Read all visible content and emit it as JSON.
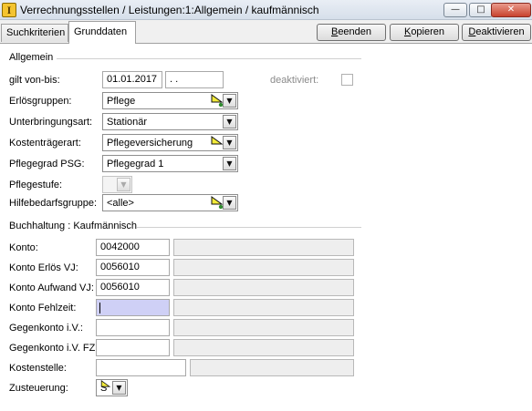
{
  "window": {
    "title": "Verrechnungsstellen / Leistungen:1:Allgemein / kaufmännisch",
    "app_icon_letter": "I",
    "minimize_glyph": "—",
    "maximize_glyph": "□",
    "close_glyph": "✕"
  },
  "tabs": [
    {
      "label": "Suchkriterien",
      "active": false
    },
    {
      "label": "Grunddaten",
      "active": true
    }
  ],
  "toolbar": {
    "beenden": {
      "pre": "",
      "key": "B",
      "post": "eenden"
    },
    "kopieren": {
      "pre": "",
      "key": "K",
      "post": "opieren"
    },
    "deaktivieren": {
      "pre": "",
      "key": "D",
      "post": "eaktivieren"
    }
  },
  "allgemein": {
    "section_title": "Allgemein",
    "gilt_label": "gilt von-bis:",
    "gilt_von": "01.01.2017",
    "gilt_bis": " .  .",
    "deaktiviert_label": "deaktiviert:",
    "deaktiviert_checked": false,
    "erloesgruppen_label": "Erlösgruppen:",
    "erloesgruppen_value": "Pflege",
    "unterbringungsart_label": "Unterbringungsart:",
    "unterbringungsart_value": "Stationär",
    "kostentraegerart_label": "Kostenträgerart:",
    "kostentraegerart_value": "Pflegeversicherung",
    "pflegegrad_label": "Pflegegrad PSG:",
    "pflegegrad_value": "Pflegegrad 1",
    "pflegestufe_label": "Pflegestufe:",
    "pflegestufe_value": "",
    "hilfebedarf_label": "Hilfebedarfsgruppe:",
    "hilfebedarf_value": "<alle>"
  },
  "buchhaltung": {
    "section_title": "Buchhaltung : Kaufmännisch",
    "rows": [
      {
        "label": "Konto:",
        "value": "0042000",
        "desc": ""
      },
      {
        "label": "Konto Erlös VJ:",
        "value": "0056010",
        "desc": ""
      },
      {
        "label": "Konto Aufwand VJ:",
        "value": "0056010",
        "desc": ""
      },
      {
        "label": "Konto Fehlzeit:",
        "value": "",
        "desc": ""
      },
      {
        "label": "Gegenkonto i.V.:",
        "value": "",
        "desc": ""
      },
      {
        "label": "Gegenkonto i.V. FZ:",
        "value": "",
        "desc": ""
      },
      {
        "label": "Kostenstelle:",
        "value": "",
        "desc": ""
      }
    ],
    "zusteuerung_label": "Zusteuerung:",
    "zusteuerung_value": "S"
  },
  "colors": {
    "flag_yellow": "#f2ea3a",
    "flag_green": "#2e8b2e",
    "focus_field": "#cfd0f6"
  },
  "icons": {
    "dropdown": "▼",
    "flag": "yellow-flag-with-green-dot"
  }
}
